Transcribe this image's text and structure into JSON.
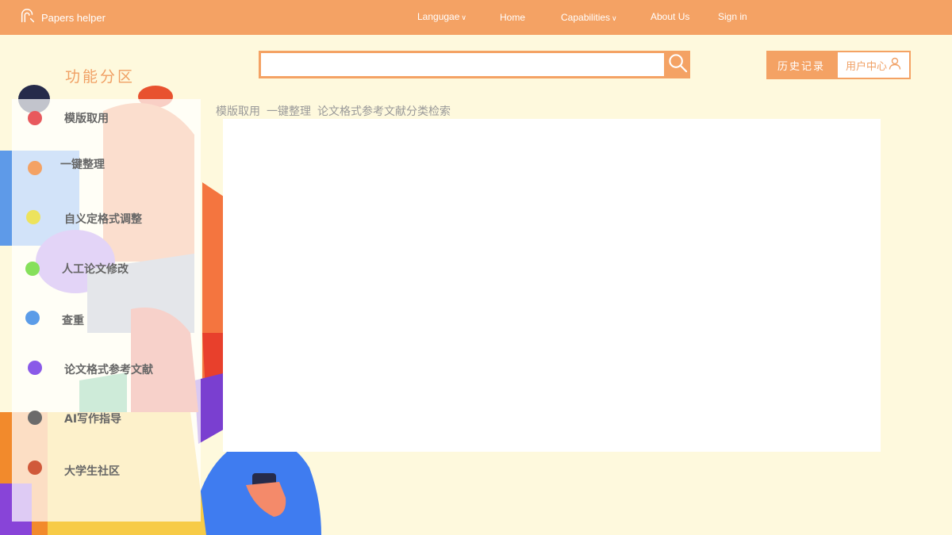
{
  "brand": {
    "name": "Papers helper",
    "icon": "logo-icon"
  },
  "nav": {
    "language": "Langugae",
    "home": "Home",
    "capabilities": "Capabilities",
    "about": "About Us",
    "signin": "Sign in",
    "chevron": "∨"
  },
  "section_title": "功能分区",
  "search": {
    "value": "",
    "placeholder": "",
    "icon": "search-icon"
  },
  "history_button": "历史记录",
  "user_button": {
    "label": "用户中心",
    "icon": "user-icon"
  },
  "tabs": [
    "模版取用",
    "一键整理",
    "论文格式参考文献分类检索"
  ],
  "sidebar": {
    "items": [
      {
        "label": "模版取用",
        "color": "#e8595d"
      },
      {
        "label": "一键整理",
        "color": "#f4a264"
      },
      {
        "label": "自义定格式调整",
        "color": "#ede35c"
      },
      {
        "label": "人工论文修改",
        "color": "#86e05b"
      },
      {
        "label": "查重",
        "color": "#5b9ce8"
      },
      {
        "label": "论文格式参考文献",
        "color": "#8a5ae8"
      },
      {
        "label": "AI写作指导",
        "color": "#6b6b6b"
      },
      {
        "label": "大学生社区",
        "color": "#d0593a"
      }
    ]
  },
  "colors": {
    "accent": "#f4a264",
    "background": "#fef9dd",
    "panel": "#ffffff"
  }
}
